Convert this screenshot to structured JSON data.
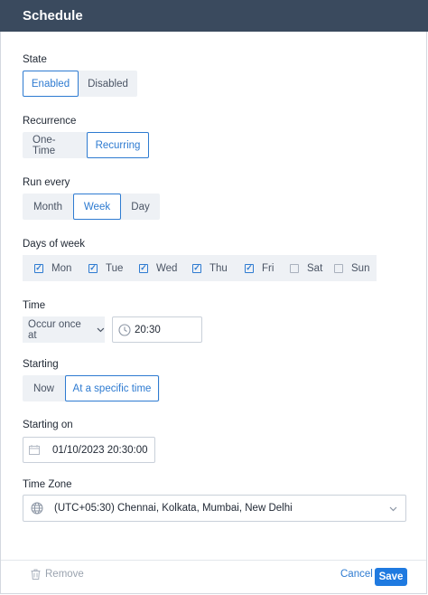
{
  "header": {
    "title": "Schedule"
  },
  "state": {
    "label": "State",
    "options": [
      "Enabled",
      "Disabled"
    ],
    "selected": "Enabled"
  },
  "recurrence": {
    "label": "Recurrence",
    "options": [
      "One-Time",
      "Recurring"
    ],
    "selected": "Recurring"
  },
  "run_every": {
    "label": "Run every",
    "options": [
      "Month",
      "Week",
      "Day"
    ],
    "selected": "Week"
  },
  "days": {
    "label": "Days of week",
    "items": [
      {
        "label": "Mon",
        "checked": true
      },
      {
        "label": "Tue",
        "checked": true
      },
      {
        "label": "Wed",
        "checked": true
      },
      {
        "label": "Thu",
        "checked": true
      },
      {
        "label": "Fri",
        "checked": true
      },
      {
        "label": "Sat",
        "checked": false
      },
      {
        "label": "Sun",
        "checked": false
      }
    ]
  },
  "time": {
    "label": "Time",
    "mode": "Occur once at",
    "value": "20:30"
  },
  "starting": {
    "label": "Starting",
    "options": [
      "Now",
      "At a specific time"
    ],
    "selected": "At a specific time"
  },
  "starting_on": {
    "label": "Starting on",
    "value": "01/10/2023 20:30:00"
  },
  "time_zone": {
    "label": "Time Zone",
    "value": "(UTC+05:30) Chennai, Kolkata, Mumbai, New Delhi"
  },
  "footer": {
    "remove_label": "Remove",
    "cancel_label": "Cancel",
    "save_label": "Save"
  },
  "colors": {
    "header_bg": "#3a4a5e",
    "accent": "#2e7bd1",
    "save_bg": "#1f7ae0"
  }
}
